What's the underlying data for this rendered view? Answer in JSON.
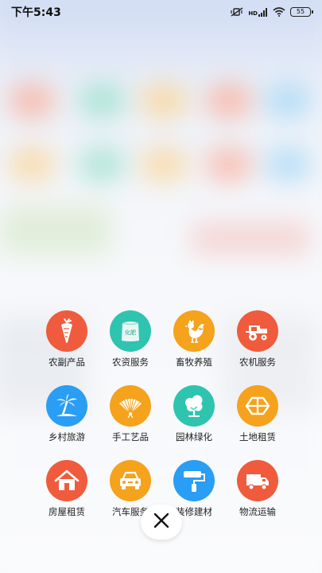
{
  "status_bar": {
    "time": "下午5:43",
    "network": "HD",
    "battery": "55"
  },
  "colors": {
    "red": "#ef5b3c",
    "teal": "#2ec4b0",
    "orange": "#f5a21d",
    "blue": "#2a9df4"
  },
  "categories": [
    {
      "label": "农副产品",
      "icon": "carrot-icon",
      "color": "#ef5b3c"
    },
    {
      "label": "农资服务",
      "icon": "fertilizer-bag-icon",
      "color": "#2ec4b0",
      "badge": "化肥"
    },
    {
      "label": "畜牧养殖",
      "icon": "rooster-icon",
      "color": "#f5a21d"
    },
    {
      "label": "农机服务",
      "icon": "tractor-icon",
      "color": "#ef5b3c"
    },
    {
      "label": "乡村旅游",
      "icon": "palm-tree-icon",
      "color": "#2a9df4"
    },
    {
      "label": "手工艺品",
      "icon": "fan-icon",
      "color": "#f5a21d"
    },
    {
      "label": "园林绿化",
      "icon": "tree-icon",
      "color": "#2ec4b0"
    },
    {
      "label": "土地租赁",
      "icon": "land-plots-icon",
      "color": "#f5a21d"
    },
    {
      "label": "房屋租赁",
      "icon": "house-icon",
      "color": "#ef5b3c"
    },
    {
      "label": "汽车服务",
      "icon": "car-icon",
      "color": "#f5a21d"
    },
    {
      "label": "装修建材",
      "icon": "paint-roller-icon",
      "color": "#2a9df4"
    },
    {
      "label": "物流运输",
      "icon": "truck-icon",
      "color": "#ef5b3c"
    }
  ],
  "close_icon": "close-icon"
}
